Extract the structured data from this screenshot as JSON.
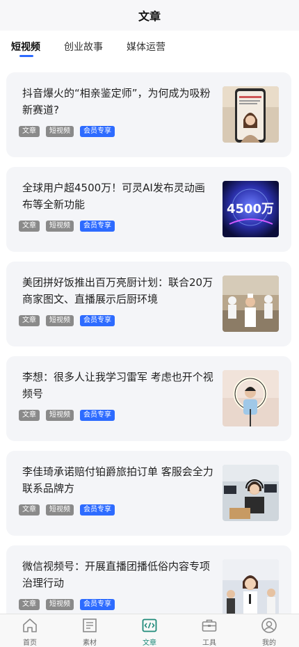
{
  "header": {
    "title": "文章"
  },
  "tabs": [
    {
      "label": "短视频",
      "active": true
    },
    {
      "label": "创业故事",
      "active": false
    },
    {
      "label": "媒体运营",
      "active": false
    }
  ],
  "articles": [
    {
      "title": "抖音爆火的“相亲鉴定师”，为何成为吸粉新赛道?",
      "tags": [
        "文章",
        "短视频",
        "会员专享"
      ]
    },
    {
      "title": "全球用户超4500万！可灵AI发布灵动画布等全新功能",
      "tags": [
        "文章",
        "短视频",
        "会员专享"
      ],
      "thumb_text": "4500万"
    },
    {
      "title": "美团拼好饭推出百万亮厨计划：联合20万商家图文、直播展示后厨环境",
      "tags": [
        "文章",
        "短视频",
        "会员专享"
      ]
    },
    {
      "title": "李想：很多人让我学习雷军 考虑也开个视频号",
      "tags": [
        "文章",
        "短视频",
        "会员专享"
      ]
    },
    {
      "title": "李佳琦承诺赔付铂爵旅拍订单 客服会全力联系品牌方",
      "tags": [
        "文章",
        "短视频",
        "会员专享"
      ]
    },
    {
      "title": "微信视频号：开展直播团播低俗内容专项治理行动",
      "tags": [
        "文章",
        "短视频",
        "会员专享"
      ]
    }
  ],
  "tabbar": [
    {
      "label": "首页",
      "icon": "home-icon",
      "active": false
    },
    {
      "label": "素材",
      "icon": "material-icon",
      "active": false
    },
    {
      "label": "文章",
      "icon": "article-code-icon",
      "active": true
    },
    {
      "label": "工具",
      "icon": "toolbox-icon",
      "active": false
    },
    {
      "label": "我的",
      "icon": "profile-icon",
      "active": false
    }
  ],
  "colors": {
    "accent": "#2d6bff",
    "tab_active": "#1f8a7a",
    "tag_gray": "#8a8a8a"
  }
}
